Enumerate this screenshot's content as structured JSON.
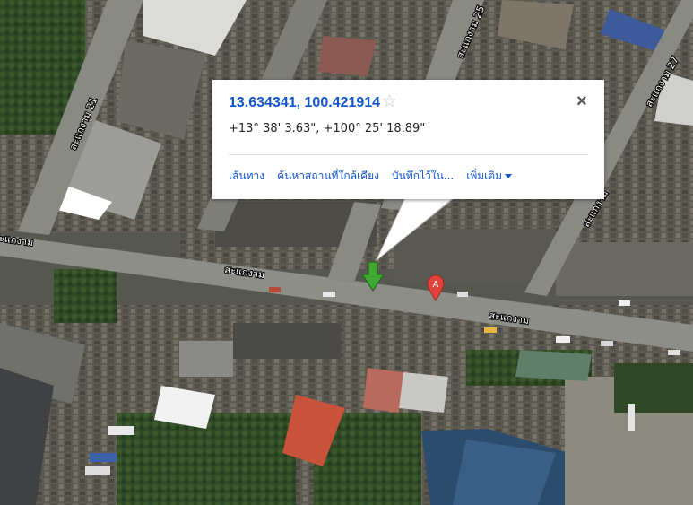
{
  "map": {
    "type": "satellite",
    "road_labels": {
      "soi_21": "สะแกงาม 21",
      "soi_25": "สะแกงาม 25",
      "soi_27": "สะแกงาม 27",
      "main_road_a": "สะแกงาม",
      "main_road_b": "สะแกงาม",
      "main_road_c": "สะแกงาม",
      "main_road_d": "สะแกงาม"
    },
    "marker_a_label": "A",
    "marker_a_color": "#e0433a",
    "arrow_marker_color": "#3ea832"
  },
  "popup": {
    "coordinates": "13.634341, 100.421914",
    "dms": "+13° 38' 3.63\", +100° 25' 18.89\"",
    "actions": {
      "directions": "เส้นทาง",
      "search_nearby": "ค้นหาสถานที่ใกล้เคียง",
      "save_to": "บันทึกไว้ใน...",
      "more": "เพิ่มเติม"
    },
    "star_icon": "star-icon",
    "close_icon": "close-icon"
  }
}
